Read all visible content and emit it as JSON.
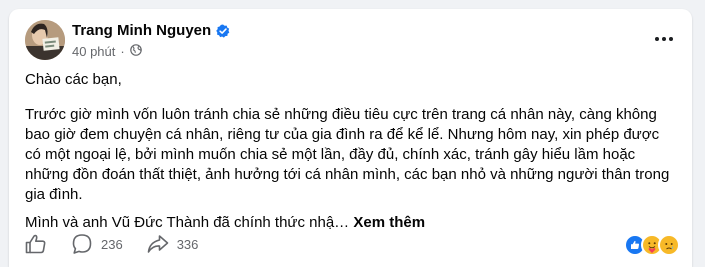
{
  "post": {
    "author_name": "Trang Minh Nguyen",
    "timestamp": "40 phút",
    "audience_icon": "globe-icon",
    "verified_icon": "verified-badge-icon",
    "greeting": "Chào các bạn,",
    "paragraph": "Trước giờ mình vốn luôn tránh chia sẻ những điều tiêu cực trên trang cá nhân này, càng không bao giờ đem chuyện cá nhân, riêng tư của gia đình ra để kể lể. Nhưng hôm nay, xin phép được có một ngoại lệ, bởi mình muốn chia sẻ một lần, đầy đủ, chính xác, tránh gây hiểu lầm hoặc những đồn đoán thất thiệt, ảnh hưởng tới cá nhân mình, các bạn nhỏ và những người thân trong gia đình.",
    "truncated_line": "Mình và anh Vũ Đức Thành đã chính thức nhậ…",
    "see_more_label": "Xem thêm"
  },
  "actions": {
    "like_icon": "thumbs-up-icon",
    "comment_icon": "comment-icon",
    "comment_count": "236",
    "share_icon": "share-icon",
    "share_count": "336"
  },
  "reactions": [
    "like",
    "care",
    "sad"
  ],
  "colors": {
    "verified": "#1877f2",
    "secondary_text": "#65676b",
    "like_reaction": "#1877f2",
    "emoji_yellow": "#f7b928"
  }
}
